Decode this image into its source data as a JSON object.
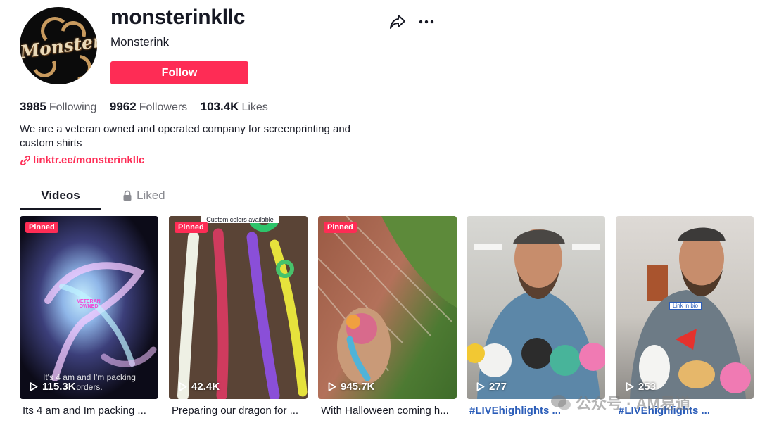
{
  "profile": {
    "avatar_logo_text": "Monster",
    "username": "monsterinkllc",
    "nickname": "Monsterink",
    "follow_label": "Follow",
    "bio": "We are a veteran owned and operated company for screenprinting and custom shirts",
    "link": "linktr.ee/monsterinkllc"
  },
  "stats": [
    {
      "value": "3985",
      "label": "Following"
    },
    {
      "value": "9962",
      "label": "Followers"
    },
    {
      "value": "103.4K",
      "label": "Likes"
    }
  ],
  "tabs": {
    "videos": "Videos",
    "liked": "Liked"
  },
  "videos": [
    {
      "pinned": "Pinned",
      "views": "115.3K",
      "caption": "Its 4 am and Im packing ...",
      "overlay": "It's 4 am and I'm packing orders.",
      "sticker": "VETERAN OWNED"
    },
    {
      "pinned": "Pinned",
      "views": "42.4K",
      "caption": "Preparing our dragon for ...",
      "overlay": "Custom colors available"
    },
    {
      "pinned": "Pinned",
      "views": "945.7K",
      "caption": "With Halloween coming h..."
    },
    {
      "views": "277",
      "caption": "#LIVEhighlights ..."
    },
    {
      "views": "253",
      "caption": "#LIVEhighlights ...",
      "overlay": "Link in bio"
    }
  ],
  "watermark": {
    "text": "公众号 · AM易道"
  },
  "colors": {
    "accent": "#fe2c55",
    "hashtag": "#2b5db9",
    "muted": "#57585f"
  },
  "icons": [
    "share-icon",
    "more-icon",
    "link-icon",
    "lock-icon",
    "play-icon"
  ]
}
